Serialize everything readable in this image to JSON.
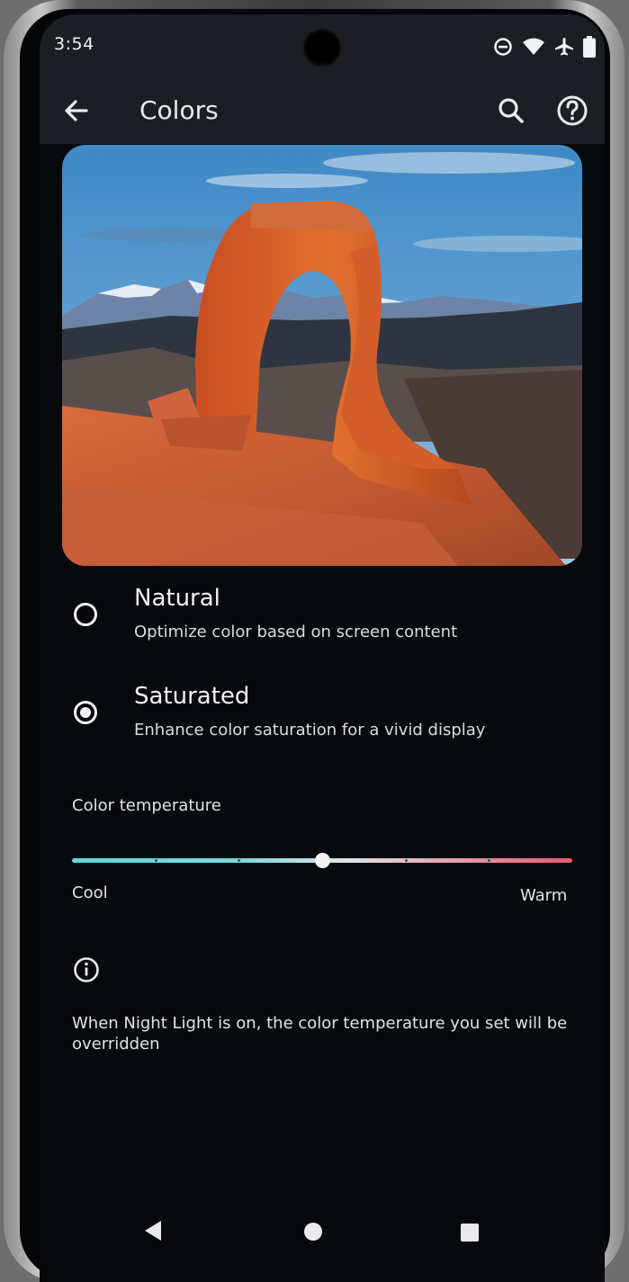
{
  "status_bar": {
    "time": "3:54",
    "icons": [
      "do-not-disturb-icon",
      "wifi-icon",
      "airplane-mode-icon",
      "battery-icon"
    ]
  },
  "app_bar": {
    "title": "Colors",
    "back_icon": "arrow-back-icon",
    "search_icon": "search-icon",
    "help_icon": "help-icon"
  },
  "preview": {
    "image": "delicate-arch-landscape"
  },
  "options": [
    {
      "title": "Natural",
      "subtitle": "Optimize color based on screen content",
      "selected": false
    },
    {
      "title": "Saturated",
      "subtitle": "Enhance color saturation for a vivid display",
      "selected": true
    }
  ],
  "color_temperature": {
    "label": "Color temperature",
    "min_label": "Cool",
    "max_label": "Warm",
    "value": 0.5,
    "steps": 7,
    "colors": {
      "cool": "#5ed6e0",
      "neutral": "#dfe3e8",
      "warm": "#e75a70"
    }
  },
  "info": {
    "icon": "info-icon",
    "text": "When Night Light is on, the color temperature you set will be overridden"
  },
  "nav_bar": {
    "back": "nav-back-icon",
    "home": "nav-home-icon",
    "recents": "nav-recents-icon"
  }
}
